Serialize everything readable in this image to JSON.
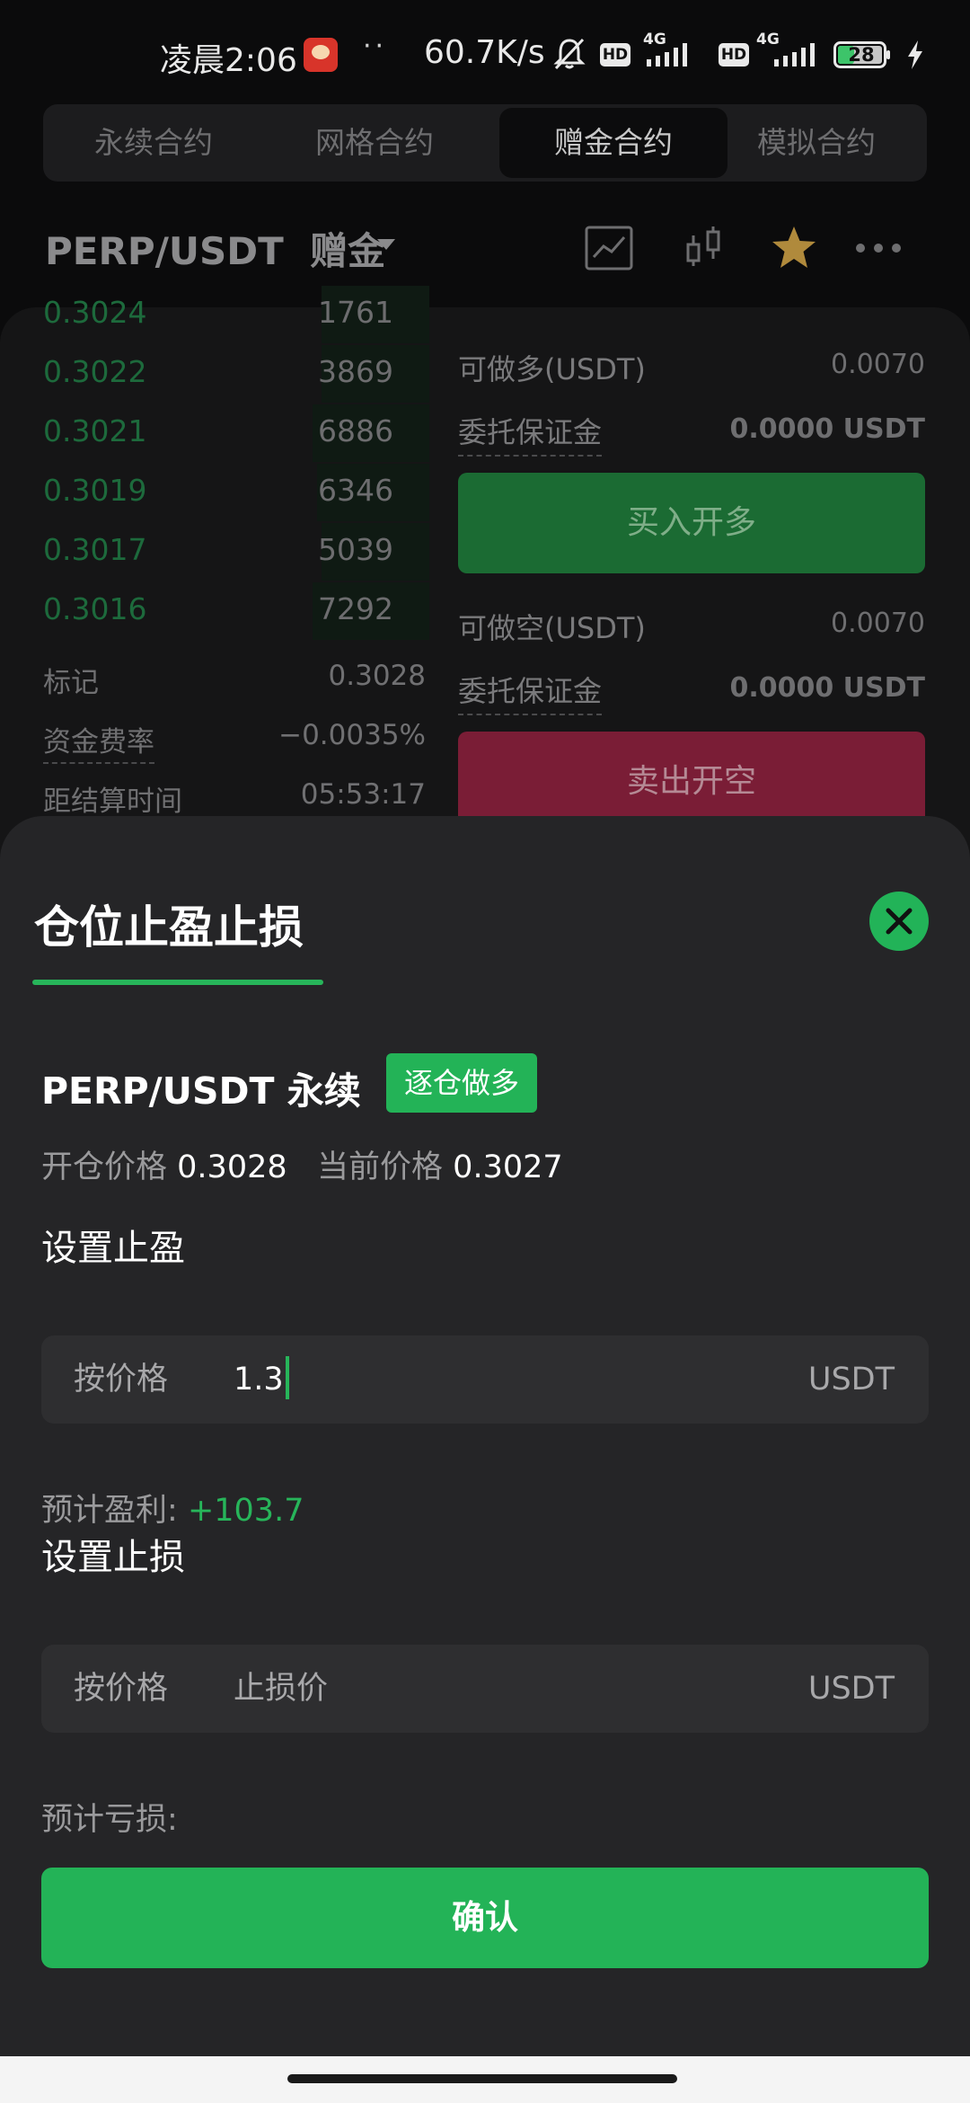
{
  "status_bar": {
    "time": "凌晨2:06",
    "dots": "··",
    "net_speed": "60.7K/s",
    "hd": "HD",
    "network": "4G",
    "battery": "28"
  },
  "tabs": [
    {
      "label": "永续合约",
      "active": false
    },
    {
      "label": "网格合约",
      "active": false
    },
    {
      "label": "赠金合约",
      "active": true
    },
    {
      "label": "模拟合约",
      "active": false
    }
  ],
  "header": {
    "pair": "PERP/USDT",
    "mode": "赠金",
    "icons": [
      "line-chart-icon",
      "candlestick-icon",
      "star-icon",
      "more-icon"
    ],
    "star_color": "#b08a3c"
  },
  "order_book": {
    "rows": [
      {
        "price": "0.3024",
        "qty": "1761"
      },
      {
        "price": "0.3022",
        "qty": "3869"
      },
      {
        "price": "0.3021",
        "qty": "6886"
      },
      {
        "price": "0.3019",
        "qty": "6346"
      },
      {
        "price": "0.3017",
        "qty": "5039"
      },
      {
        "price": "0.3016",
        "qty": "7292"
      }
    ],
    "mark_label": "标记",
    "mark_value": "0.3028",
    "funding_label": "资金费率",
    "funding_value": "−0.0035%",
    "settle_label": "距结算时间",
    "settle_value": "05:53:17"
  },
  "trade_panel": {
    "long_avail_label": "可做多(USDT)",
    "long_avail_value": "0.0070",
    "long_margin_label": "委托保证金",
    "long_margin_value": "0.0000 USDT",
    "buy_label": "买入开多",
    "short_avail_label": "可做空(USDT)",
    "short_avail_value": "0.0070",
    "short_margin_label": "委托保证金",
    "short_margin_value": "0.0000 USDT",
    "sell_label": "卖出开空"
  },
  "sheet": {
    "title": "仓位止盈止损",
    "position_name": "PERP/USDT 永续",
    "position_tag": "逐仓做多",
    "open_price_label": "开仓价格",
    "open_price": "0.3028",
    "current_price_label": "当前价格",
    "current_price": "0.3027",
    "take_profit": {
      "title": "设置止盈",
      "label": "按价格",
      "value": "1.3",
      "unit": "USDT",
      "estimate_label": "预计盈利:",
      "estimate_value": "+103.7"
    },
    "stop_loss": {
      "title": "设置止损",
      "label": "按价格",
      "placeholder": "止损价",
      "unit": "USDT",
      "estimate_label": "预计亏损:"
    },
    "confirm_label": "确认",
    "accent_color": "#23b357"
  }
}
